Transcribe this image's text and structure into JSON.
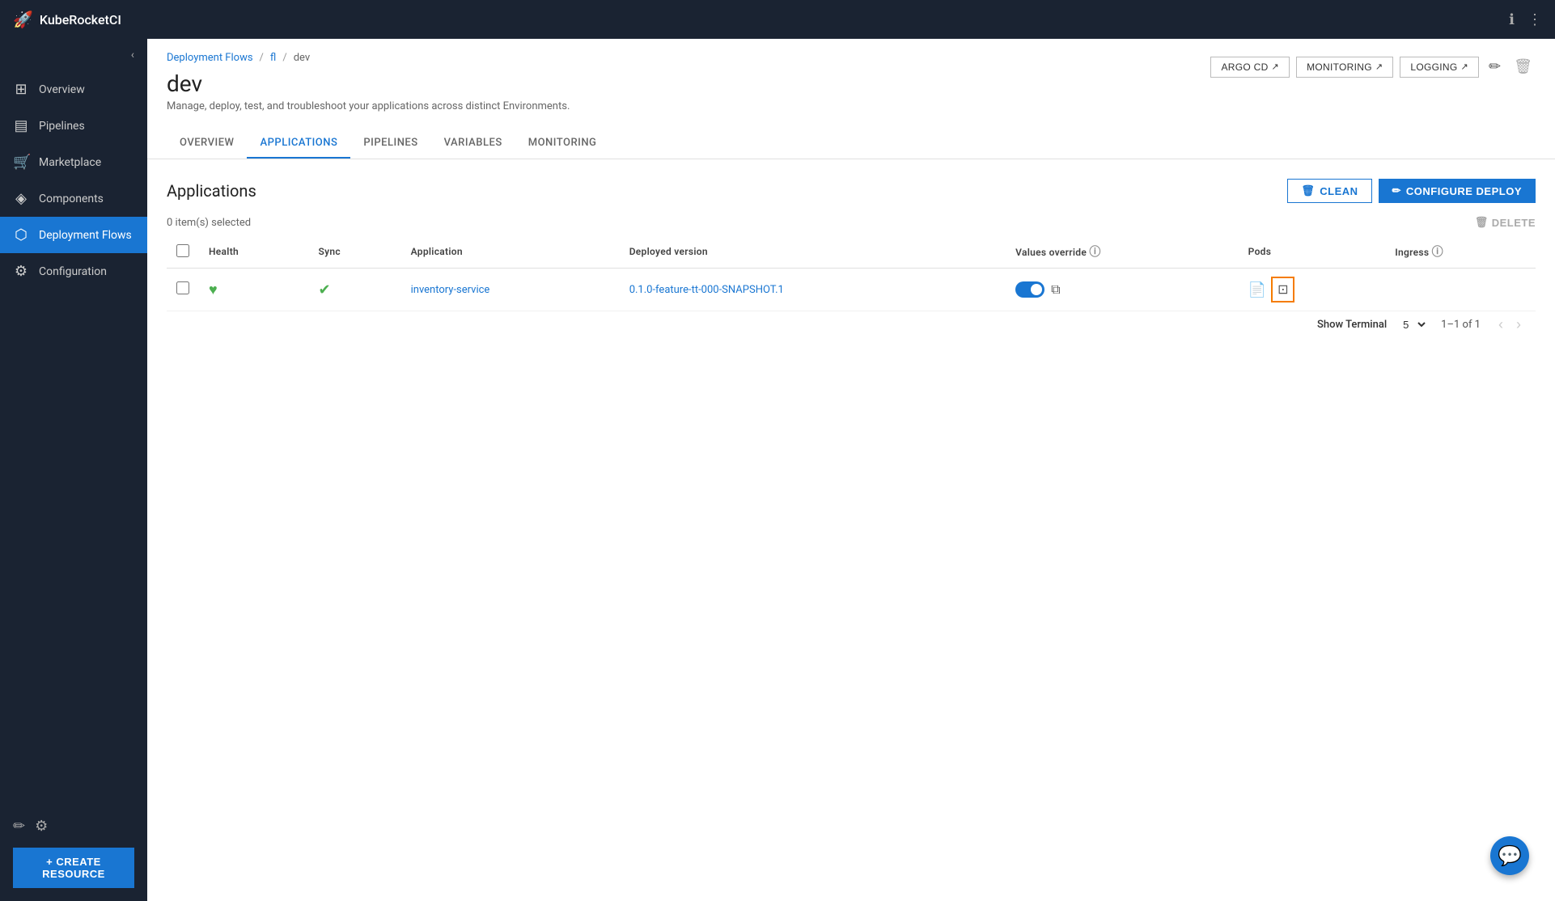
{
  "app": {
    "title": "KubeRocketCI",
    "logo": "🚀"
  },
  "topbar": {
    "info_icon": "ℹ",
    "more_icon": "⋮"
  },
  "sidebar": {
    "collapse_icon": "‹",
    "items": [
      {
        "id": "overview",
        "label": "Overview",
        "icon": "⊞"
      },
      {
        "id": "pipelines",
        "label": "Pipelines",
        "icon": "▤"
      },
      {
        "id": "marketplace",
        "label": "Marketplace",
        "icon": "🛒"
      },
      {
        "id": "components",
        "label": "Components",
        "icon": "◈"
      },
      {
        "id": "deployment-flows",
        "label": "Deployment Flows",
        "icon": "⬢",
        "active": true
      },
      {
        "id": "configuration",
        "label": "Configuration",
        "icon": "⚙"
      }
    ],
    "bottom": {
      "edit_icon": "✏",
      "settings_icon": "⚙"
    },
    "create_resource_label": "+ CREATE RESOURCE"
  },
  "breadcrumb": {
    "items": [
      {
        "label": "Deployment Flows",
        "link": true
      },
      {
        "label": "fl",
        "link": true
      },
      {
        "label": "dev",
        "link": false
      }
    ]
  },
  "page": {
    "title": "dev",
    "subtitle": "Manage, deploy, test, and troubleshoot your applications across distinct Environments.",
    "actions": {
      "argo_cd": "ARGO CD",
      "monitoring": "MONITORING",
      "logging": "LOGGING",
      "edit_icon": "✏",
      "delete_icon": "🗑"
    }
  },
  "tabs": [
    {
      "id": "overview",
      "label": "OVERVIEW"
    },
    {
      "id": "applications",
      "label": "APPLICATIONS",
      "active": true
    },
    {
      "id": "pipelines",
      "label": "PIPELINES"
    },
    {
      "id": "variables",
      "label": "VARIABLES"
    },
    {
      "id": "monitoring",
      "label": "MONITORING"
    }
  ],
  "applications": {
    "title": "Applications",
    "selected_count": "0 item(s) selected",
    "delete_label": "DELETE",
    "clean_label": "CLEAN",
    "configure_deploy_label": "CONFIGURE DEPLOY",
    "columns": [
      {
        "id": "health",
        "label": "Health"
      },
      {
        "id": "sync",
        "label": "Sync"
      },
      {
        "id": "application",
        "label": "Application"
      },
      {
        "id": "deployed_version",
        "label": "Deployed version"
      },
      {
        "id": "values_override",
        "label": "Values override"
      },
      {
        "id": "pods",
        "label": "Pods"
      },
      {
        "id": "ingress",
        "label": "Ingress"
      }
    ],
    "rows": [
      {
        "id": "inventory-service",
        "health": "♥",
        "sync": "✔",
        "application": "inventory-service",
        "deployed_version": "0.1.0-feature-tt-000-SNAPSHOT.1",
        "has_toggle": true,
        "toggle_on": true,
        "has_ext_link": true
      }
    ],
    "show_terminal_label": "Show Terminal",
    "per_page": "5",
    "pagination": "1–1 of 1"
  },
  "fab": {
    "icon": "💬"
  }
}
